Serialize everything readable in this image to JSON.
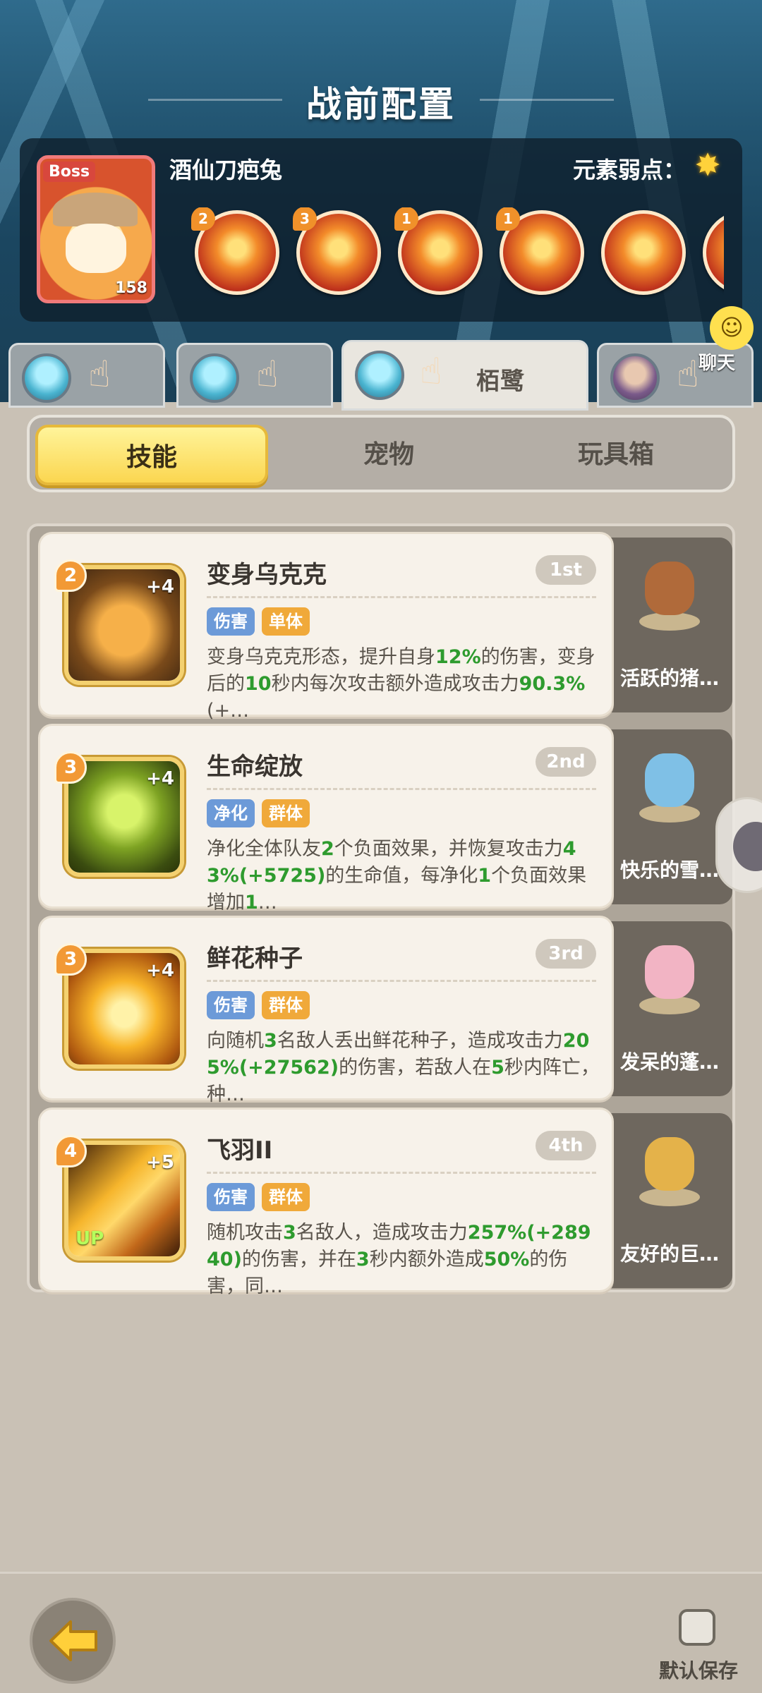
{
  "header": {
    "title": "战前配置"
  },
  "boss": {
    "tag": "Boss",
    "name": "酒仙刀疤兔",
    "level": "158",
    "weakness_label": "元素弱点：",
    "weakness_icon": "star-element-icon",
    "skills": [
      {
        "level": "2",
        "icon": "fire-chain-icon"
      },
      {
        "level": "3",
        "icon": "fire-slash-icon"
      },
      {
        "level": "1",
        "icon": "fire-burst-icon"
      },
      {
        "level": "1",
        "icon": "fire-punch-icon"
      },
      {
        "level": "",
        "icon": "explosion-icon"
      }
    ]
  },
  "char_tabs": [
    {
      "name": "",
      "active": false
    },
    {
      "name": "",
      "active": false
    },
    {
      "name": "栢鹭",
      "active": true
    },
    {
      "name": "",
      "active": false
    }
  ],
  "chat": {
    "label": "聊天"
  },
  "tabs": [
    {
      "label": "技能",
      "active": true
    },
    {
      "label": "宠物",
      "active": false
    },
    {
      "label": "玩具箱",
      "active": false
    }
  ],
  "skills": [
    {
      "level": "2",
      "plus": "+4",
      "up": "",
      "name": "变身乌克克",
      "rank": "1st",
      "tags": [
        "伤害",
        "单体"
      ],
      "desc": "变身乌克克形态，提升自身12%的伤害，变身后的10秒内每次攻击额外造成攻击力90.3%(+…",
      "pet_name": "活跃的猪…"
    },
    {
      "level": "3",
      "plus": "+4",
      "up": "",
      "name": "生命绽放",
      "rank": "2nd",
      "tags": [
        "净化",
        "群体"
      ],
      "desc": "净化全体队友2个负面效果，并恢复攻击力43%(+5725)的生命值，每净化1个负面效果增加1…",
      "pet_name": "快乐的雪…"
    },
    {
      "level": "3",
      "plus": "+4",
      "up": "",
      "name": "鲜花种子",
      "rank": "3rd",
      "tags": [
        "伤害",
        "群体"
      ],
      "desc": "向随机3名敌人丢出鲜花种子，造成攻击力205%(+27562)的伤害，若敌人在5秒内阵亡，种…",
      "pet_name": "发呆的蓬…"
    },
    {
      "level": "4",
      "plus": "+5",
      "up": "UP",
      "name": "飞羽II",
      "rank": "4th",
      "tags": [
        "伤害",
        "群体"
      ],
      "desc": "随机攻击3名敌人，造成攻击力257%(+28940)的伤害，并在3秒内额外造成50%的伤害，同…",
      "pet_name": "友好的巨…"
    }
  ],
  "footer": {
    "save_label": "默认保存"
  }
}
